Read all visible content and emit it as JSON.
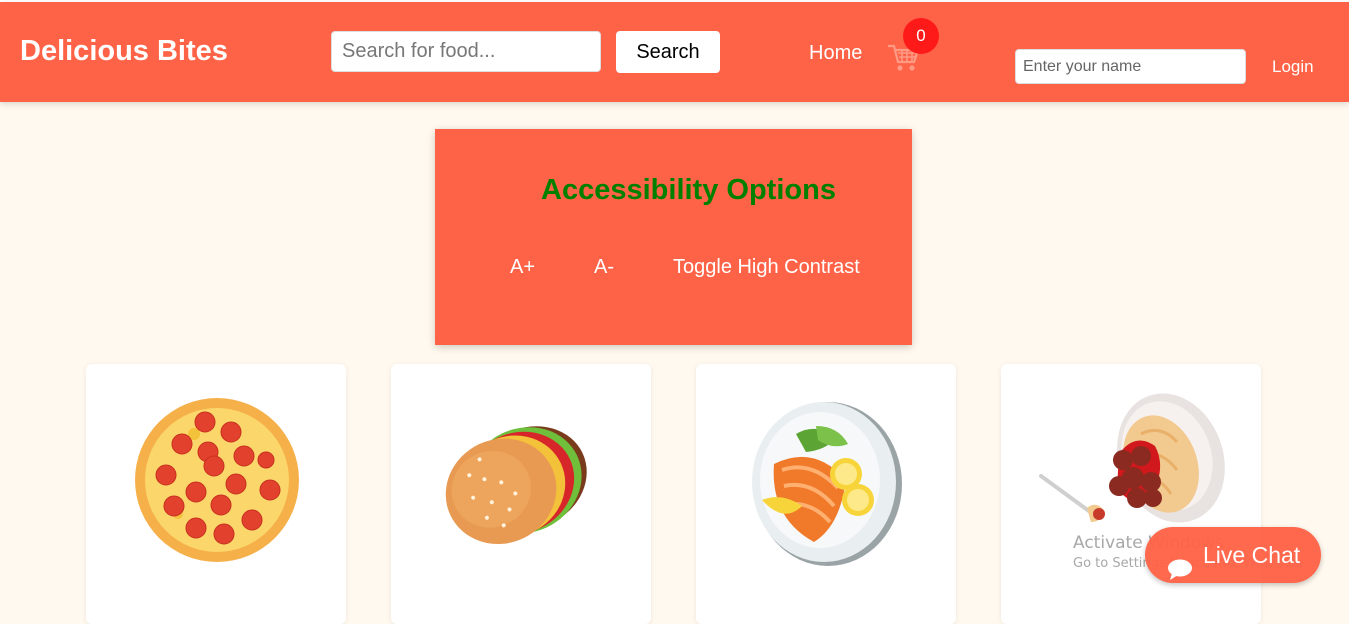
{
  "header": {
    "brand": "Delicious Bites",
    "search_placeholder": "Search for food...",
    "search_button": "Search",
    "nav_home": "Home",
    "cart_count": "0",
    "name_placeholder": "Enter your name",
    "login": "Login"
  },
  "accessibility": {
    "title": "Accessibility Options",
    "increase": "A+",
    "decrease": "A-",
    "contrast": "Toggle High Contrast"
  },
  "products": [
    {
      "icon": "pizza"
    },
    {
      "icon": "burger"
    },
    {
      "icon": "salmon-plate"
    },
    {
      "icon": "spaghetti"
    }
  ],
  "watermark": {
    "title": "Activate Windows",
    "subtitle": "Go to Settings to activate Windows."
  },
  "live_chat": {
    "label": "Live Chat"
  },
  "colors": {
    "primary": "#ff6347",
    "background": "#fff9ef",
    "accessibility_title": "#008000",
    "badge": "#ff1a1a"
  }
}
